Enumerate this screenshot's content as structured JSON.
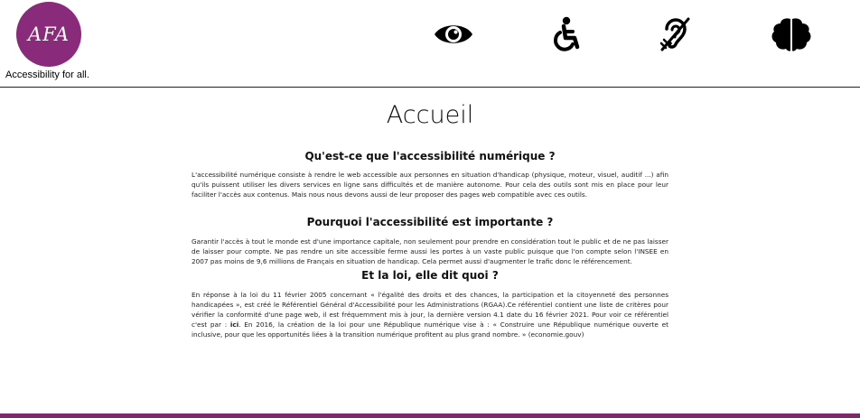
{
  "header": {
    "logo_text": "AFA",
    "tagline": "Accessibility for all.",
    "brand_color": "#8a2a7a",
    "nav_icons": [
      "eye-icon",
      "wheelchair-icon",
      "deaf-ear-icon",
      "brain-icon"
    ]
  },
  "main": {
    "title": "Accueil",
    "sections": [
      {
        "title": "Qu'est-ce que l'accessibilité numérique ?",
        "paragraph": "L'accessibilité numérique consiste à rendre le web accessible aux personnes en situation d'handicap (physique, moteur, visuel, auditif ...) afin qu'ils puissent utiliser les divers services en ligne sans difficultés et de manière autonome. Pour cela des outils sont mis en place pour leur faciliter l'accès aux contenus. Mais nous nous devons aussi de leur proposer des pages web compatible avec ces outils."
      },
      {
        "title": "Pourquoi l'accessibilité est importante ?",
        "paragraph": "Garantir l'accès à tout le monde est d'une importance capitale, non seulement pour prendre en considération tout le public et de ne pas laisser de laisser pour compte. Ne pas rendre un site accessible ferme aussi les portes à un vaste public puisque que l'on compte selon l'INSEE en 2007 pas moins de 9,6 millions de Français en situation de handicap. Cela permet aussi d'augmenter le trafic donc le référencement."
      },
      {
        "title": "Et la loi, elle dit quoi ?",
        "paragraph_before": "En réponse à la loi du 11 février 2005 concernant « l'égalité des droits et des chances, la participation et la citoyenneté des personnes handicapées », est créé le Référentiel Général d'Accessibilité pour les Administrations (RGAA).Ce référentiel contient une liste de critères pour vérifier la conformité d'une page web, il est fréquemment mis à jour, la dernière version 4.1 date du 16 février 2021. Pour voir ce référentiel c'est par : ",
        "paragraph_link": "ici",
        "paragraph_after": ". En 2016, la création de la loi pour une République numérique vise à : « Construire une République numérique ouverte et inclusive, pour que les opportunités liées à la transition numérique profitent au plus grand nombre. » (economie.gouv)"
      }
    ]
  },
  "footer": {
    "bar_color": "#7d2a6d"
  }
}
